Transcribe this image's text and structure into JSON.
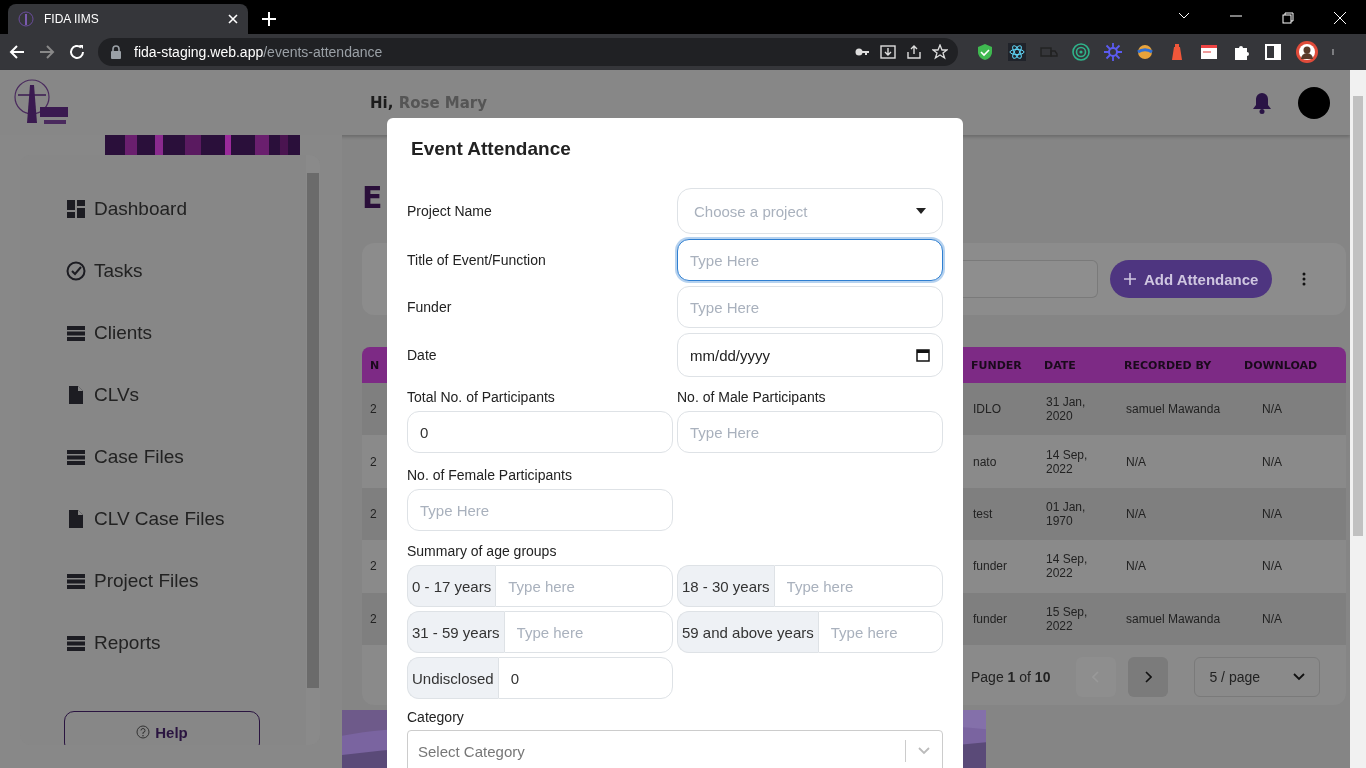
{
  "browser": {
    "tab_title": "FIDA IIMS",
    "url_host": "fida-staging.web.app",
    "url_path": "/events-attendance"
  },
  "header": {
    "greeting": "Hi,",
    "user_name": "Rose Mary"
  },
  "sidebar": {
    "items": [
      {
        "label": "Dashboard"
      },
      {
        "label": "Tasks"
      },
      {
        "label": "Clients"
      },
      {
        "label": "CLVs"
      },
      {
        "label": "Case Files"
      },
      {
        "label": "CLV Case Files"
      },
      {
        "label": "Project Files"
      },
      {
        "label": "Reports"
      }
    ],
    "help": "Help"
  },
  "page": {
    "heading": "E",
    "add_button": "Add Attendance"
  },
  "table": {
    "columns": [
      "N",
      "FUNDER",
      "DATE",
      "RECORDED BY",
      "DOWNLOAD"
    ],
    "rows": [
      {
        "no": "2",
        "funder": "IDLO",
        "date": "31 Jan, 2020",
        "recorded_by": "samuel Mawanda",
        "download": "N/A"
      },
      {
        "no": "2",
        "funder": "nato",
        "date": "14 Sep, 2022",
        "recorded_by": "N/A",
        "download": "N/A"
      },
      {
        "no": "2",
        "funder": "test",
        "date": "01 Jan, 1970",
        "recorded_by": "N/A",
        "download": "N/A"
      },
      {
        "no": "2",
        "funder": "funder",
        "date": "14 Sep, 2022",
        "recorded_by": "N/A",
        "download": "N/A"
      },
      {
        "no": "2",
        "funder": "funder",
        "date": "15 Sep, 2022",
        "recorded_by": "samuel Mawanda",
        "download": "N/A"
      }
    ]
  },
  "pagination": {
    "summary": "Page **1** of **10**",
    "buttons": [
      {
        "kind": "prev",
        "disabled": true
      },
      {
        "kind": "next",
        "disabled": false
      }
    ],
    "per_page": "5 / page"
  },
  "modal": {
    "title": "Event Attendance",
    "fields": [
      {
        "label": "Project Name",
        "kind": "select",
        "placeholder": "Choose a project",
        "focused": false
      },
      {
        "label": "Title of Event/Function",
        "kind": "text",
        "placeholder": "Type Here",
        "focused": true
      },
      {
        "label": "Funder",
        "kind": "text",
        "placeholder": "Type Here",
        "focused": false
      },
      {
        "label": "Date",
        "kind": "date",
        "value": "mm/dd/yyyy",
        "focused": false
      }
    ],
    "participants": [
      {
        "label": "Total No. of Participants",
        "value": "0"
      },
      {
        "label": "No. of Male Participants",
        "placeholder": "Type Here"
      },
      {
        "label": "No. of Female Participants",
        "placeholder": "Type Here"
      }
    ],
    "age_summary_label": "Summary of age groups",
    "age_groups": [
      {
        "label": "0 - 17 years",
        "placeholder": "Type here"
      },
      {
        "label": "18 - 30 years",
        "placeholder": "Type here"
      },
      {
        "label": "31 - 59 years",
        "placeholder": "Type here"
      },
      {
        "label": "59 and above years",
        "placeholder": "Type here"
      },
      {
        "label": "Undisclosed",
        "value": "0"
      }
    ],
    "category_label": "Category",
    "category_placeholder": "Select Category"
  }
}
